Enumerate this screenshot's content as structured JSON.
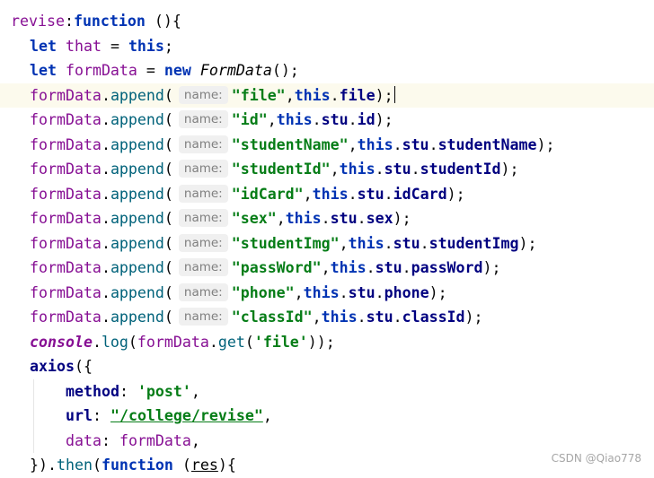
{
  "editor": {
    "lines": [
      {
        "indent": 12,
        "current": false,
        "tokens": [
          {
            "c": "prop",
            "t": "revise"
          },
          {
            "c": "t",
            "t": ":"
          },
          {
            "c": "kw",
            "t": "function"
          },
          {
            "c": "t",
            "t": " (){"
          }
        ]
      },
      {
        "indent": 33,
        "current": false,
        "tokens": [
          {
            "c": "kw",
            "t": "let"
          },
          {
            "c": "t",
            "t": " "
          },
          {
            "c": "var",
            "t": "that"
          },
          {
            "c": "t",
            "t": " = "
          },
          {
            "c": "kw",
            "t": "this"
          },
          {
            "c": "t",
            "t": ";"
          }
        ]
      },
      {
        "indent": 33,
        "current": false,
        "tokens": [
          {
            "c": "kw",
            "t": "let"
          },
          {
            "c": "t",
            "t": " "
          },
          {
            "c": "var",
            "t": "formData"
          },
          {
            "c": "t",
            "t": " = "
          },
          {
            "c": "kw",
            "t": "new"
          },
          {
            "c": "t",
            "t": " "
          },
          {
            "c": "cls",
            "t": "FormData"
          },
          {
            "c": "t",
            "t": "();"
          }
        ]
      },
      {
        "indent": 33,
        "current": true,
        "tokens": [
          {
            "c": "var",
            "t": "formData"
          },
          {
            "c": "t",
            "t": "."
          },
          {
            "c": "fn",
            "t": "append"
          },
          {
            "c": "t",
            "t": "("
          },
          {
            "c": "hint",
            "t": "name:"
          },
          {
            "c": "str",
            "t": "\"file\""
          },
          {
            "c": "t",
            "t": ","
          },
          {
            "c": "kw",
            "t": "this"
          },
          {
            "c": "t",
            "t": "."
          },
          {
            "c": "prop-b",
            "t": "file"
          },
          {
            "c": "t",
            "t": ");"
          },
          {
            "c": "caret",
            "t": ""
          }
        ]
      },
      {
        "indent": 33,
        "current": false,
        "tokens": [
          {
            "c": "var",
            "t": "formData"
          },
          {
            "c": "t",
            "t": "."
          },
          {
            "c": "fn",
            "t": "append"
          },
          {
            "c": "t",
            "t": "("
          },
          {
            "c": "hint",
            "t": "name:"
          },
          {
            "c": "str",
            "t": "\"id\""
          },
          {
            "c": "t",
            "t": ","
          },
          {
            "c": "kw",
            "t": "this"
          },
          {
            "c": "t",
            "t": "."
          },
          {
            "c": "prop-b",
            "t": "stu"
          },
          {
            "c": "t",
            "t": "."
          },
          {
            "c": "prop-b",
            "t": "id"
          },
          {
            "c": "t",
            "t": ");"
          }
        ]
      },
      {
        "indent": 33,
        "current": false,
        "tokens": [
          {
            "c": "var",
            "t": "formData"
          },
          {
            "c": "t",
            "t": "."
          },
          {
            "c": "fn",
            "t": "append"
          },
          {
            "c": "t",
            "t": "("
          },
          {
            "c": "hint",
            "t": "name:"
          },
          {
            "c": "str",
            "t": "\"studentName\""
          },
          {
            "c": "t",
            "t": ","
          },
          {
            "c": "kw",
            "t": "this"
          },
          {
            "c": "t",
            "t": "."
          },
          {
            "c": "prop-b",
            "t": "stu"
          },
          {
            "c": "t",
            "t": "."
          },
          {
            "c": "prop-b",
            "t": "studentName"
          },
          {
            "c": "t",
            "t": ");"
          }
        ]
      },
      {
        "indent": 33,
        "current": false,
        "tokens": [
          {
            "c": "var",
            "t": "formData"
          },
          {
            "c": "t",
            "t": "."
          },
          {
            "c": "fn",
            "t": "append"
          },
          {
            "c": "t",
            "t": "("
          },
          {
            "c": "hint",
            "t": "name:"
          },
          {
            "c": "str",
            "t": "\"studentId\""
          },
          {
            "c": "t",
            "t": ","
          },
          {
            "c": "kw",
            "t": "this"
          },
          {
            "c": "t",
            "t": "."
          },
          {
            "c": "prop-b",
            "t": "stu"
          },
          {
            "c": "t",
            "t": "."
          },
          {
            "c": "prop-b",
            "t": "studentId"
          },
          {
            "c": "t",
            "t": ");"
          }
        ]
      },
      {
        "indent": 33,
        "current": false,
        "tokens": [
          {
            "c": "var",
            "t": "formData"
          },
          {
            "c": "t",
            "t": "."
          },
          {
            "c": "fn",
            "t": "append"
          },
          {
            "c": "t",
            "t": "("
          },
          {
            "c": "hint",
            "t": "name:"
          },
          {
            "c": "str",
            "t": "\"idCard\""
          },
          {
            "c": "t",
            "t": ","
          },
          {
            "c": "kw",
            "t": "this"
          },
          {
            "c": "t",
            "t": "."
          },
          {
            "c": "prop-b",
            "t": "stu"
          },
          {
            "c": "t",
            "t": "."
          },
          {
            "c": "prop-b",
            "t": "idCard"
          },
          {
            "c": "t",
            "t": ");"
          }
        ]
      },
      {
        "indent": 33,
        "current": false,
        "tokens": [
          {
            "c": "var",
            "t": "formData"
          },
          {
            "c": "t",
            "t": "."
          },
          {
            "c": "fn",
            "t": "append"
          },
          {
            "c": "t",
            "t": "("
          },
          {
            "c": "hint",
            "t": "name:"
          },
          {
            "c": "str",
            "t": "\"sex\""
          },
          {
            "c": "t",
            "t": ","
          },
          {
            "c": "kw",
            "t": "this"
          },
          {
            "c": "t",
            "t": "."
          },
          {
            "c": "prop-b",
            "t": "stu"
          },
          {
            "c": "t",
            "t": "."
          },
          {
            "c": "prop-b",
            "t": "sex"
          },
          {
            "c": "t",
            "t": ");"
          }
        ]
      },
      {
        "indent": 33,
        "current": false,
        "tokens": [
          {
            "c": "var",
            "t": "formData"
          },
          {
            "c": "t",
            "t": "."
          },
          {
            "c": "fn",
            "t": "append"
          },
          {
            "c": "t",
            "t": "("
          },
          {
            "c": "hint",
            "t": "name:"
          },
          {
            "c": "str",
            "t": "\"studentImg\""
          },
          {
            "c": "t",
            "t": ","
          },
          {
            "c": "kw",
            "t": "this"
          },
          {
            "c": "t",
            "t": "."
          },
          {
            "c": "prop-b",
            "t": "stu"
          },
          {
            "c": "t",
            "t": "."
          },
          {
            "c": "prop-b",
            "t": "studentImg"
          },
          {
            "c": "t",
            "t": ");"
          }
        ]
      },
      {
        "indent": 33,
        "current": false,
        "tokens": [
          {
            "c": "var",
            "t": "formData"
          },
          {
            "c": "t",
            "t": "."
          },
          {
            "c": "fn",
            "t": "append"
          },
          {
            "c": "t",
            "t": "("
          },
          {
            "c": "hint",
            "t": "name:"
          },
          {
            "c": "str",
            "t": "\"passWord\""
          },
          {
            "c": "t",
            "t": ","
          },
          {
            "c": "kw",
            "t": "this"
          },
          {
            "c": "t",
            "t": "."
          },
          {
            "c": "prop-b",
            "t": "stu"
          },
          {
            "c": "t",
            "t": "."
          },
          {
            "c": "prop-b",
            "t": "passWord"
          },
          {
            "c": "t",
            "t": ");"
          }
        ]
      },
      {
        "indent": 33,
        "current": false,
        "tokens": [
          {
            "c": "var",
            "t": "formData"
          },
          {
            "c": "t",
            "t": "."
          },
          {
            "c": "fn",
            "t": "append"
          },
          {
            "c": "t",
            "t": "("
          },
          {
            "c": "hint",
            "t": "name:"
          },
          {
            "c": "str",
            "t": "\"phone\""
          },
          {
            "c": "t",
            "t": ","
          },
          {
            "c": "kw",
            "t": "this"
          },
          {
            "c": "t",
            "t": "."
          },
          {
            "c": "prop-b",
            "t": "stu"
          },
          {
            "c": "t",
            "t": "."
          },
          {
            "c": "prop-b",
            "t": "phone"
          },
          {
            "c": "t",
            "t": ");"
          }
        ]
      },
      {
        "indent": 33,
        "current": false,
        "tokens": [
          {
            "c": "var",
            "t": "formData"
          },
          {
            "c": "t",
            "t": "."
          },
          {
            "c": "fn",
            "t": "append"
          },
          {
            "c": "t",
            "t": "("
          },
          {
            "c": "hint",
            "t": "name:"
          },
          {
            "c": "str",
            "t": "\"classId\""
          },
          {
            "c": "t",
            "t": ","
          },
          {
            "c": "kw",
            "t": "this"
          },
          {
            "c": "t",
            "t": "."
          },
          {
            "c": "prop-b",
            "t": "stu"
          },
          {
            "c": "t",
            "t": "."
          },
          {
            "c": "prop-b",
            "t": "classId"
          },
          {
            "c": "t",
            "t": ");"
          }
        ]
      },
      {
        "indent": 33,
        "current": false,
        "tokens": [
          {
            "c": "obj",
            "t": "console"
          },
          {
            "c": "t",
            "t": "."
          },
          {
            "c": "fn",
            "t": "log"
          },
          {
            "c": "t",
            "t": "("
          },
          {
            "c": "var",
            "t": "formData"
          },
          {
            "c": "t",
            "t": "."
          },
          {
            "c": "fn",
            "t": "get"
          },
          {
            "c": "t",
            "t": "("
          },
          {
            "c": "str",
            "t": "'file'"
          },
          {
            "c": "t",
            "t": "));"
          }
        ]
      },
      {
        "indent": 33,
        "current": false,
        "tokens": [
          {
            "c": "prop-b",
            "t": "axios"
          },
          {
            "c": "t",
            "t": "({"
          }
        ]
      },
      {
        "indent": 73,
        "current": false,
        "tokens": [
          {
            "c": "prop-b",
            "t": "method"
          },
          {
            "c": "t",
            "t": ": "
          },
          {
            "c": "str",
            "t": "'post'"
          },
          {
            "c": "t",
            "t": ","
          }
        ]
      },
      {
        "indent": 73,
        "current": false,
        "tokens": [
          {
            "c": "prop-b",
            "t": "url"
          },
          {
            "c": "t",
            "t": ": "
          },
          {
            "c": "str under",
            "t": "\"/college/revise\""
          },
          {
            "c": "t",
            "t": ","
          }
        ]
      },
      {
        "indent": 73,
        "current": false,
        "tokens": [
          {
            "c": "prop",
            "t": "data"
          },
          {
            "c": "t",
            "t": ": "
          },
          {
            "c": "var",
            "t": "formData"
          },
          {
            "c": "t",
            "t": ","
          }
        ]
      },
      {
        "indent": 33,
        "current": false,
        "tokens": [
          {
            "c": "t",
            "t": "})."
          },
          {
            "c": "fn",
            "t": "then"
          },
          {
            "c": "t",
            "t": "("
          },
          {
            "c": "kw",
            "t": "function"
          },
          {
            "c": "t",
            "t": " ("
          },
          {
            "c": "ident under",
            "t": "res"
          },
          {
            "c": "t",
            "t": "){"
          }
        ]
      }
    ]
  },
  "watermark": "CSDN @Qiao778"
}
